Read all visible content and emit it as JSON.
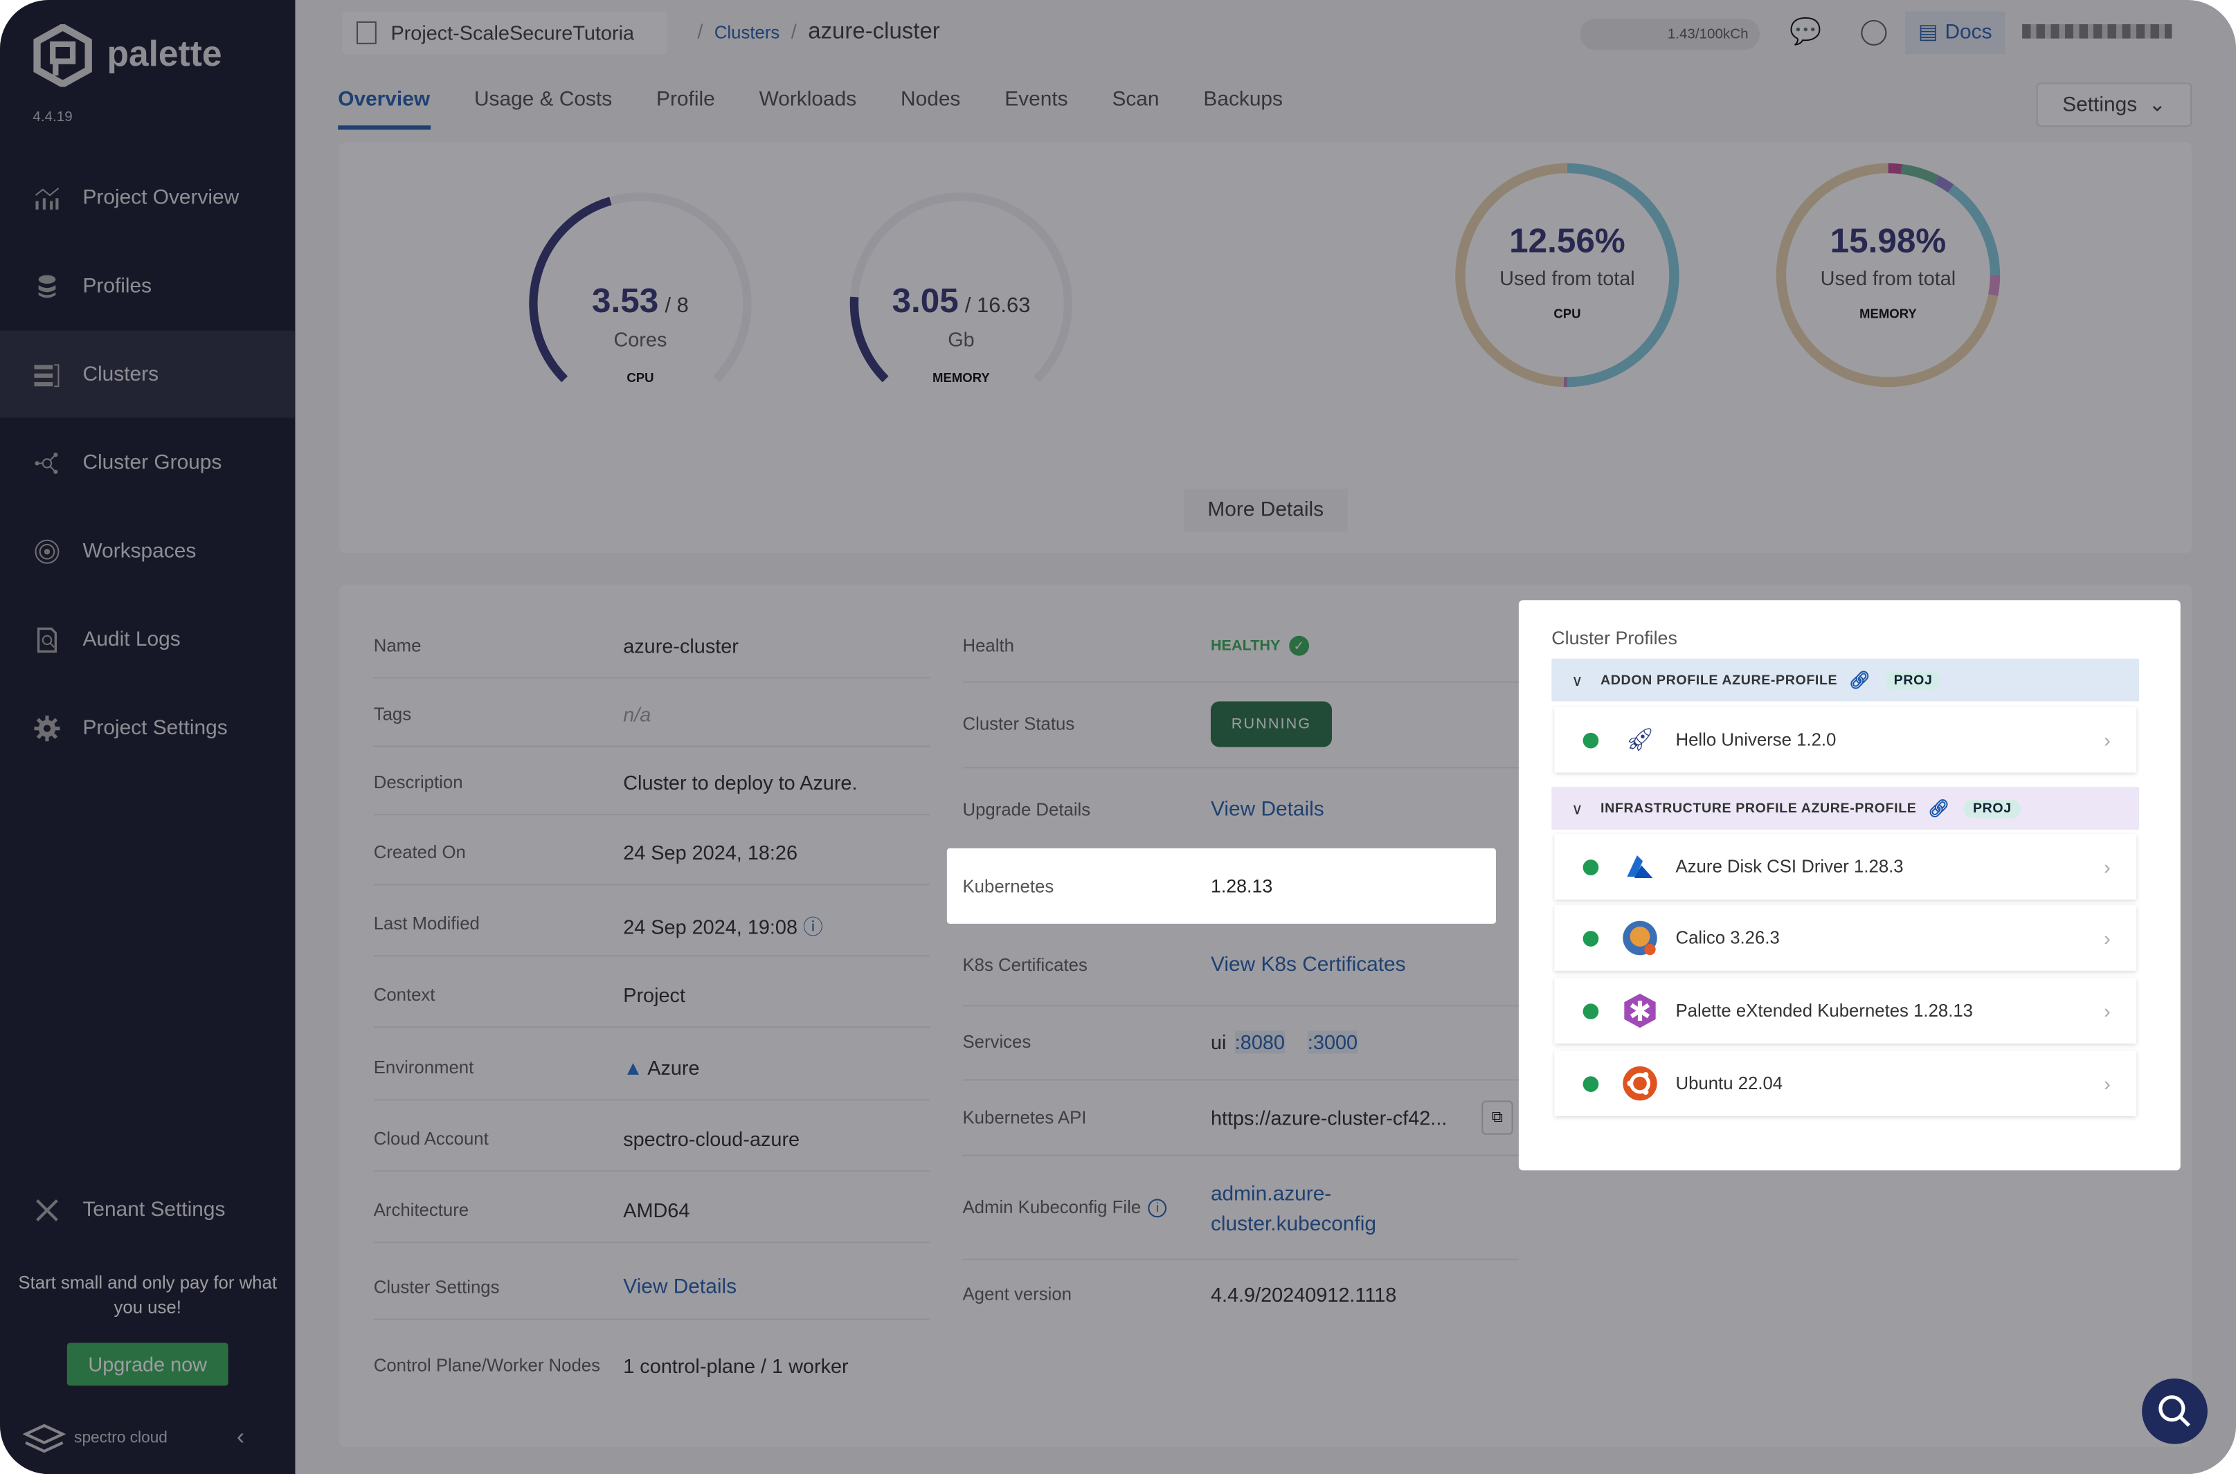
{
  "sidebar": {
    "brand": "palette",
    "version": "4.4.19",
    "items": [
      {
        "label": "Project Overview",
        "icon": "chart-icon"
      },
      {
        "label": "Profiles",
        "icon": "stack-icon"
      },
      {
        "label": "Clusters",
        "icon": "server-icon",
        "active": true
      },
      {
        "label": "Cluster Groups",
        "icon": "network-icon"
      },
      {
        "label": "Workspaces",
        "icon": "target-icon"
      },
      {
        "label": "Audit Logs",
        "icon": "document-search-icon"
      },
      {
        "label": "Project Settings",
        "icon": "gear-icon"
      }
    ],
    "tenant_settings": "Tenant Settings",
    "promo": "Start small and only pay for what you use!",
    "upgrade": "Upgrade now",
    "footer": "spectro cloud"
  },
  "header": {
    "project": "Project-ScaleSecureTutoria",
    "crumb": "Clusters",
    "cluster": "azure-cluster",
    "usage": "1.43/100kCh",
    "docs": "Docs"
  },
  "tabs": [
    "Overview",
    "Usage & Costs",
    "Profile",
    "Workloads",
    "Nodes",
    "Events",
    "Scan",
    "Backups"
  ],
  "settings": "Settings",
  "gauges": [
    {
      "value": "3.53",
      "total": "/ 8",
      "unit": "Cores",
      "label": "CPU",
      "fraction": 0.44
    },
    {
      "value": "3.05",
      "total": "/ 16.63",
      "unit": "Gb",
      "label": "MEMORY",
      "fraction": 0.18
    }
  ],
  "donuts": [
    {
      "pct": "12.56%",
      "sub": "Used from total",
      "label": "CPU",
      "segments": [
        {
          "f": 0.5,
          "c": "#7ec8dc"
        },
        {
          "f": 0.005,
          "c": "#b07ab8"
        },
        {
          "f": 0.495,
          "c": "#e8cfa8"
        }
      ]
    },
    {
      "pct": "15.98%",
      "sub": "Used from total",
      "label": "MEMORY",
      "segments": [
        {
          "f": 0.02,
          "c": "#c0408a"
        },
        {
          "f": 0.055,
          "c": "#5fae8a"
        },
        {
          "f": 0.025,
          "c": "#8a78c8"
        },
        {
          "f": 0.15,
          "c": "#7ec8dc"
        },
        {
          "f": 0.03,
          "c": "#d68ac4"
        },
        {
          "f": 0.72,
          "c": "#e8cfa8"
        }
      ]
    }
  ],
  "more_details": "More Details",
  "details_left": [
    {
      "label": "Name",
      "value": "azure-cluster"
    },
    {
      "label": "Tags",
      "value": "n/a"
    },
    {
      "label": "Description",
      "value": "Cluster to deploy to Azure."
    },
    {
      "label": "Created On",
      "value": "24 Sep 2024, 18:26"
    },
    {
      "label": "Last Modified",
      "value": "24 Sep 2024, 19:08"
    },
    {
      "label": "Context",
      "value": "Project"
    },
    {
      "label": "Environment",
      "value": "Azure"
    },
    {
      "label": "Cloud Account",
      "value": "spectro-cloud-azure"
    },
    {
      "label": "Architecture",
      "value": "AMD64"
    },
    {
      "label": "Cluster Settings",
      "value": "View Details"
    },
    {
      "label": "Control Plane/Worker Nodes",
      "value": "1 control-plane / 1 worker"
    }
  ],
  "details_mid": {
    "health_label": "Health",
    "health": "HEALTHY",
    "status_label": "Cluster Status",
    "status": "RUNNING",
    "upgrade_label": "Upgrade Details",
    "upgrade": "View Details",
    "k8s_label": "Kubernetes",
    "k8s": "1.28.13",
    "cert_label": "K8s Certificates",
    "cert": "View K8s Certificates",
    "services_label": "Services",
    "services_prefix": "ui",
    "port1": ":8080",
    "port2": ":3000",
    "api_label": "Kubernetes API",
    "api": "https://azure-cluster-cf42...",
    "kubeconfig_label": "Admin Kubeconfig File",
    "kubeconfig1": "admin.azure-",
    "kubeconfig2": "cluster.kubeconfig",
    "agent_label": "Agent version",
    "agent": "4.4.9/20240912.1118"
  },
  "profiles": {
    "title": "Cluster Profiles",
    "groups": [
      {
        "name": "ADDON PROFILE AZURE-PROFILE",
        "badge": "PROJ",
        "color": "#dde8f4",
        "packs": [
          {
            "name": "Hello Universe 1.2.0",
            "icon": "rocket-icon"
          }
        ]
      },
      {
        "name": "INFRASTRUCTURE PROFILE AZURE-PROFILE",
        "badge": "PROJ",
        "color": "#ece6f6",
        "packs": [
          {
            "name": "Azure Disk CSI Driver 1.28.3",
            "icon": "azure-icon"
          },
          {
            "name": "Calico 3.26.3",
            "icon": "calico-cat-icon"
          },
          {
            "name": "Palette eXtended Kubernetes 1.28.13",
            "icon": "pxk-icon"
          },
          {
            "name": "Ubuntu 22.04",
            "icon": "ubuntu-icon"
          }
        ]
      }
    ]
  }
}
